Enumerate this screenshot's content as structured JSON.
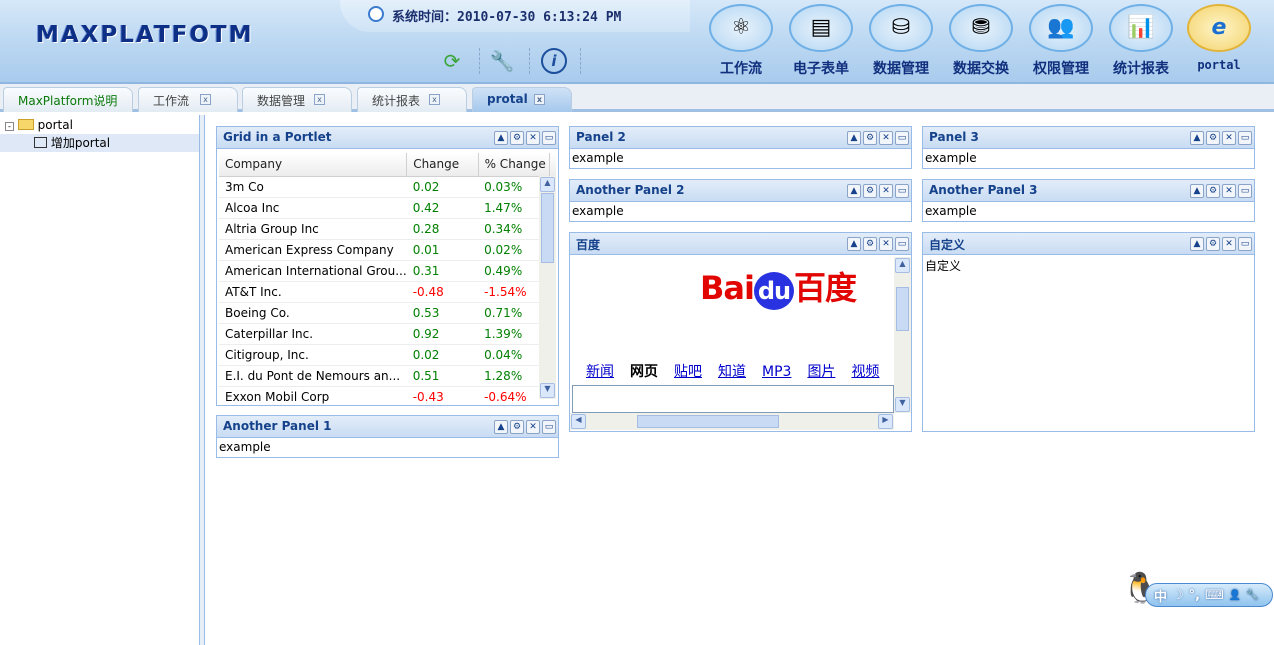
{
  "header": {
    "logo": "MAXPLATFOTM",
    "time_label": "系统时间：2010-07-30 6:13:24 PM",
    "tools": [
      {
        "icon": "refresh-icon"
      },
      {
        "icon": "wrench-icon"
      },
      {
        "icon": "info-icon"
      }
    ],
    "nav": [
      {
        "label": "工作流",
        "icon": "workflow-icon"
      },
      {
        "label": "电子表单",
        "icon": "form-icon"
      },
      {
        "label": "数据管理",
        "icon": "database-gear-icon"
      },
      {
        "label": "数据交换",
        "icon": "database-sync-icon"
      },
      {
        "label": "权限管理",
        "icon": "users-key-icon"
      },
      {
        "label": "统计报表",
        "icon": "bar-chart-icon"
      },
      {
        "label": "portal",
        "icon": "ie-icon",
        "active": true
      }
    ]
  },
  "tabs": [
    {
      "label": "MaxPlatform说明"
    },
    {
      "label": "工作流"
    },
    {
      "label": "数据管理"
    },
    {
      "label": "统计报表"
    },
    {
      "label": "protal",
      "active": true
    }
  ],
  "tree": {
    "root": "portal",
    "child": "增加portal"
  },
  "grid": {
    "title": "Grid in a Portlet",
    "columns": [
      "Company",
      "Change",
      "% Change"
    ],
    "rows": [
      [
        "3m Co",
        "0.02",
        "0.03%"
      ],
      [
        "Alcoa Inc",
        "0.42",
        "1.47%"
      ],
      [
        "Altria Group Inc",
        "0.28",
        "0.34%"
      ],
      [
        "American Express Company",
        "0.01",
        "0.02%"
      ],
      [
        "American International Grou...",
        "0.31",
        "0.49%"
      ],
      [
        "AT&T Inc.",
        "-0.48",
        "-1.54%"
      ],
      [
        "Boeing Co.",
        "0.53",
        "0.71%"
      ],
      [
        "Caterpillar Inc.",
        "0.92",
        "1.39%"
      ],
      [
        "Citigroup, Inc.",
        "0.02",
        "0.04%"
      ],
      [
        "E.I. du Pont de Nemours an...",
        "0.51",
        "1.28%"
      ],
      [
        "Exxon Mobil Corp",
        "-0.43",
        "-0.64%"
      ]
    ]
  },
  "panels": {
    "ap1": {
      "title": "Another Panel 1",
      "body": "example"
    },
    "p2": {
      "title": "Panel 2",
      "body": "example"
    },
    "ap2": {
      "title": "Another Panel 2",
      "body": "example"
    },
    "p3": {
      "title": "Panel 3",
      "body": "example"
    },
    "ap3": {
      "title": "Another Panel 3",
      "body": "example"
    },
    "custom": {
      "title": "自定义",
      "body": "自定义"
    },
    "baidu": {
      "title": "百度",
      "logo_text": "Bai du 百度",
      "links": [
        "新闻",
        "网页",
        "贴吧",
        "知道",
        "MP3",
        "图片",
        "视频"
      ]
    }
  },
  "ime": {
    "items": [
      "中",
      "☽",
      "°,",
      "⌨",
      "👤",
      "🔧"
    ]
  },
  "colors": {
    "accent": "#15428b",
    "border": "#99bbe8",
    "positive": "#008000",
    "negative": "#ff0000"
  }
}
